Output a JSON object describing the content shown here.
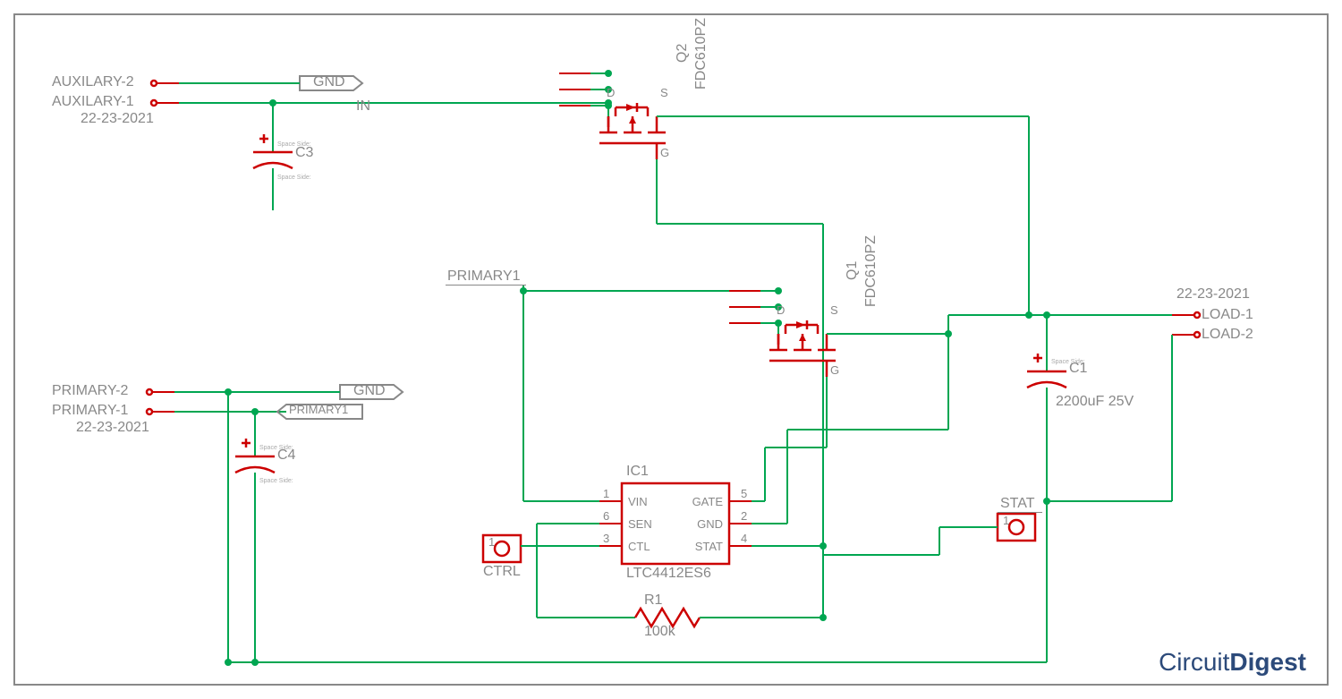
{
  "connectors": {
    "aux2_label": "AUXILARY-2",
    "aux1_label": "AUXILARY-1",
    "aux_date": "22-23-2021",
    "pri2_label": "PRIMARY-2",
    "pri1_label": "PRIMARY-1",
    "pri_date": "22-23-2021",
    "load1_label": "LOAD-1",
    "load2_label": "LOAD-2",
    "load_date": "22-23-2021"
  },
  "nets": {
    "gnd": "GND",
    "in": "IN",
    "primary1_net": "PRIMARY1",
    "primary1_tag": "PRIMARY1",
    "stat": "STAT"
  },
  "components": {
    "c1_ref": "C1",
    "c1_val": "2200uF 25V",
    "c3_ref": "C3",
    "c4_ref": "C4",
    "q1_ref": "Q1",
    "q1_part": "FDC610PZ",
    "q2_ref": "Q2",
    "q2_part": "FDC610PZ",
    "ic1_ref": "IC1",
    "ic1_part": "LTC4412ES6",
    "r1_ref": "R1",
    "r1_val": "100k",
    "ctrl_label": "CTRL",
    "spacer_text": "Space Side:"
  },
  "ic_pins": {
    "p1": "1",
    "p1_name": "VIN",
    "p2": "2",
    "p2_name": "GND",
    "p3": "3",
    "p3_name": "CTL",
    "p4": "4",
    "p4_name": "STAT",
    "p5": "5",
    "p5_name": "GATE",
    "p6": "6",
    "p6_name": "SEN"
  },
  "pads": {
    "one": "1"
  },
  "mosfet": {
    "d": "D",
    "g": "G",
    "s": "S"
  },
  "logo": {
    "circuit": "Circuit",
    "digest": "Digest"
  },
  "chart_data": {
    "type": "schematic",
    "ic": {
      "ref": "IC1",
      "part": "LTC4412ES6",
      "pins": [
        {
          "num": 1,
          "name": "VIN"
        },
        {
          "num": 2,
          "name": "GND"
        },
        {
          "num": 3,
          "name": "CTL"
        },
        {
          "num": 4,
          "name": "STAT"
        },
        {
          "num": 5,
          "name": "GATE"
        },
        {
          "num": 6,
          "name": "SEN"
        }
      ]
    },
    "transistors": [
      {
        "ref": "Q1",
        "part": "FDC610PZ",
        "type": "P-MOSFET"
      },
      {
        "ref": "Q2",
        "part": "FDC610PZ",
        "type": "P-MOSFET"
      }
    ],
    "capacitors": [
      {
        "ref": "C1",
        "value": "2200uF 25V",
        "type": "polarized"
      },
      {
        "ref": "C3",
        "value": "",
        "type": "polarized"
      },
      {
        "ref": "C4",
        "value": "",
        "type": "polarized"
      }
    ],
    "resistors": [
      {
        "ref": "R1",
        "value": "100k"
      }
    ],
    "connectors": [
      {
        "name": "AUXILARY",
        "pins": [
          "AUXILARY-1",
          "AUXILARY-2"
        ],
        "date": "22-23-2021"
      },
      {
        "name": "PRIMARY",
        "pins": [
          "PRIMARY-1",
          "PRIMARY-2"
        ],
        "date": "22-23-2021"
      },
      {
        "name": "LOAD",
        "pins": [
          "LOAD-1",
          "LOAD-2"
        ],
        "date": "22-23-2021"
      }
    ],
    "testpoints": [
      "CTRL",
      "STAT"
    ],
    "nets": [
      "GND",
      "IN",
      "PRIMARY1",
      "STAT"
    ]
  }
}
